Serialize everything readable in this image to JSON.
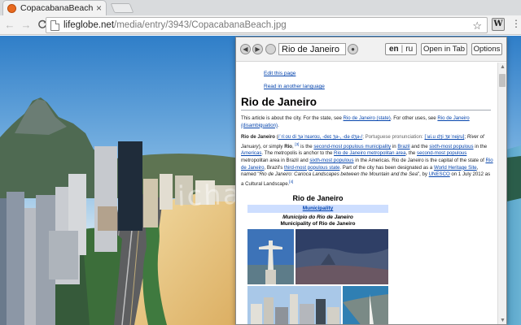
{
  "tab": {
    "title": "CopacabanaBeach.jpg (1...",
    "close_symbol": "×",
    "favicon": "brand-favicon-icon"
  },
  "toolbar": {
    "back_symbol": "←",
    "forward_symbol": "→",
    "reload_symbol": "C",
    "url_host": "lifeglobe.net",
    "url_path": "/media/entry/3943/CopacabanaBeach.jpg",
    "star_symbol": "☆",
    "extension_label": "W",
    "menu_symbol": "⋮"
  },
  "background": {
    "watermark_text": "ichaipa"
  },
  "popup": {
    "back_symbol": "◀",
    "forward_symbol": "▶",
    "search_value": "Rio de Janeiro",
    "go_symbol": "●",
    "lang_en": "en",
    "lang_sep": "|",
    "lang_ru": "ru",
    "open_tab_label": "Open in Tab",
    "options_label": "Options",
    "edit_link": "Edit this page",
    "read_lang_link": "Read in another language",
    "title": "Rio de Janeiro",
    "hatnote": {
      "t1": "This article is about the city. For the state, see ",
      "l1": "Rio de Janeiro (state)",
      "t2": ". For other uses, see ",
      "l2": "Rio de Janeiro (disambiguation)",
      "t3": "."
    },
    "intro_texts": [
      "Rio de Janeiro",
      " (",
      "/ˈriːoʊ di ʒəˈnɛəroʊ, -deɪ ʒə-, -də dʒə-/",
      "; Portuguese pronunciation: ",
      "[ˈʁi.u dʒi ʒɐˈnejɾu]",
      "; ",
      "River of January",
      "), or simply ",
      "Rio",
      ", ",
      "[3]",
      " is the ",
      "second-most populous municipality",
      " in ",
      "Brazil",
      " and the ",
      "sixth-most populous",
      " in the ",
      "Americas",
      ". The metropolis is anchor to the ",
      "Rio de Janeiro metropolitan area",
      ", the ",
      "second-most populous",
      " metropolitan area in Brazil and ",
      "sixth-most populous",
      " in the Americas. Rio de Janeiro is the capital of the state of ",
      "Rio de Janeiro",
      ", Brazil's ",
      "third-most populous state",
      ". Part of the city has been designated as a ",
      "World Heritage Site",
      ", named \"",
      "Rio de Janeiro: Carioca Landscapes between the Mountain and the Sea",
      "\", by ",
      "UNESCO",
      " on 1 July 2012 as a Cultural Landscape.",
      "[4]"
    ],
    "infobox": {
      "title": "Rio de Janeiro",
      "sub": "Municipality",
      "name_pt": "Município do Rio de Janeiro",
      "name_en": "Municipality of Rio de Janeiro"
    },
    "scroll_up": "▲",
    "scroll_down": "▼"
  },
  "colors": {
    "link": "#0645ad",
    "infobox_band": "#cddeff",
    "sky_top": "#2f7ec8",
    "sand": "#e8c47a"
  }
}
